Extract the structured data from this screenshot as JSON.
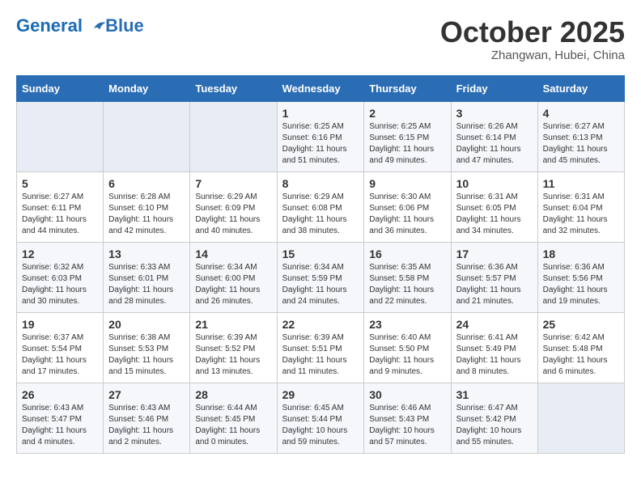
{
  "header": {
    "logo_line1": "General",
    "logo_line2": "Blue",
    "month": "October 2025",
    "location": "Zhangwan, Hubei, China"
  },
  "weekdays": [
    "Sunday",
    "Monday",
    "Tuesday",
    "Wednesday",
    "Thursday",
    "Friday",
    "Saturday"
  ],
  "weeks": [
    [
      {
        "day": "",
        "info": ""
      },
      {
        "day": "",
        "info": ""
      },
      {
        "day": "",
        "info": ""
      },
      {
        "day": "1",
        "info": "Sunrise: 6:25 AM\nSunset: 6:16 PM\nDaylight: 11 hours\nand 51 minutes."
      },
      {
        "day": "2",
        "info": "Sunrise: 6:25 AM\nSunset: 6:15 PM\nDaylight: 11 hours\nand 49 minutes."
      },
      {
        "day": "3",
        "info": "Sunrise: 6:26 AM\nSunset: 6:14 PM\nDaylight: 11 hours\nand 47 minutes."
      },
      {
        "day": "4",
        "info": "Sunrise: 6:27 AM\nSunset: 6:13 PM\nDaylight: 11 hours\nand 45 minutes."
      }
    ],
    [
      {
        "day": "5",
        "info": "Sunrise: 6:27 AM\nSunset: 6:11 PM\nDaylight: 11 hours\nand 44 minutes."
      },
      {
        "day": "6",
        "info": "Sunrise: 6:28 AM\nSunset: 6:10 PM\nDaylight: 11 hours\nand 42 minutes."
      },
      {
        "day": "7",
        "info": "Sunrise: 6:29 AM\nSunset: 6:09 PM\nDaylight: 11 hours\nand 40 minutes."
      },
      {
        "day": "8",
        "info": "Sunrise: 6:29 AM\nSunset: 6:08 PM\nDaylight: 11 hours\nand 38 minutes."
      },
      {
        "day": "9",
        "info": "Sunrise: 6:30 AM\nSunset: 6:06 PM\nDaylight: 11 hours\nand 36 minutes."
      },
      {
        "day": "10",
        "info": "Sunrise: 6:31 AM\nSunset: 6:05 PM\nDaylight: 11 hours\nand 34 minutes."
      },
      {
        "day": "11",
        "info": "Sunrise: 6:31 AM\nSunset: 6:04 PM\nDaylight: 11 hours\nand 32 minutes."
      }
    ],
    [
      {
        "day": "12",
        "info": "Sunrise: 6:32 AM\nSunset: 6:03 PM\nDaylight: 11 hours\nand 30 minutes."
      },
      {
        "day": "13",
        "info": "Sunrise: 6:33 AM\nSunset: 6:01 PM\nDaylight: 11 hours\nand 28 minutes."
      },
      {
        "day": "14",
        "info": "Sunrise: 6:34 AM\nSunset: 6:00 PM\nDaylight: 11 hours\nand 26 minutes."
      },
      {
        "day": "15",
        "info": "Sunrise: 6:34 AM\nSunset: 5:59 PM\nDaylight: 11 hours\nand 24 minutes."
      },
      {
        "day": "16",
        "info": "Sunrise: 6:35 AM\nSunset: 5:58 PM\nDaylight: 11 hours\nand 22 minutes."
      },
      {
        "day": "17",
        "info": "Sunrise: 6:36 AM\nSunset: 5:57 PM\nDaylight: 11 hours\nand 21 minutes."
      },
      {
        "day": "18",
        "info": "Sunrise: 6:36 AM\nSunset: 5:56 PM\nDaylight: 11 hours\nand 19 minutes."
      }
    ],
    [
      {
        "day": "19",
        "info": "Sunrise: 6:37 AM\nSunset: 5:54 PM\nDaylight: 11 hours\nand 17 minutes."
      },
      {
        "day": "20",
        "info": "Sunrise: 6:38 AM\nSunset: 5:53 PM\nDaylight: 11 hours\nand 15 minutes."
      },
      {
        "day": "21",
        "info": "Sunrise: 6:39 AM\nSunset: 5:52 PM\nDaylight: 11 hours\nand 13 minutes."
      },
      {
        "day": "22",
        "info": "Sunrise: 6:39 AM\nSunset: 5:51 PM\nDaylight: 11 hours\nand 11 minutes."
      },
      {
        "day": "23",
        "info": "Sunrise: 6:40 AM\nSunset: 5:50 PM\nDaylight: 11 hours\nand 9 minutes."
      },
      {
        "day": "24",
        "info": "Sunrise: 6:41 AM\nSunset: 5:49 PM\nDaylight: 11 hours\nand 8 minutes."
      },
      {
        "day": "25",
        "info": "Sunrise: 6:42 AM\nSunset: 5:48 PM\nDaylight: 11 hours\nand 6 minutes."
      }
    ],
    [
      {
        "day": "26",
        "info": "Sunrise: 6:43 AM\nSunset: 5:47 PM\nDaylight: 11 hours\nand 4 minutes."
      },
      {
        "day": "27",
        "info": "Sunrise: 6:43 AM\nSunset: 5:46 PM\nDaylight: 11 hours\nand 2 minutes."
      },
      {
        "day": "28",
        "info": "Sunrise: 6:44 AM\nSunset: 5:45 PM\nDaylight: 11 hours\nand 0 minutes."
      },
      {
        "day": "29",
        "info": "Sunrise: 6:45 AM\nSunset: 5:44 PM\nDaylight: 10 hours\nand 59 minutes."
      },
      {
        "day": "30",
        "info": "Sunrise: 6:46 AM\nSunset: 5:43 PM\nDaylight: 10 hours\nand 57 minutes."
      },
      {
        "day": "31",
        "info": "Sunrise: 6:47 AM\nSunset: 5:42 PM\nDaylight: 10 hours\nand 55 minutes."
      },
      {
        "day": "",
        "info": ""
      }
    ]
  ]
}
